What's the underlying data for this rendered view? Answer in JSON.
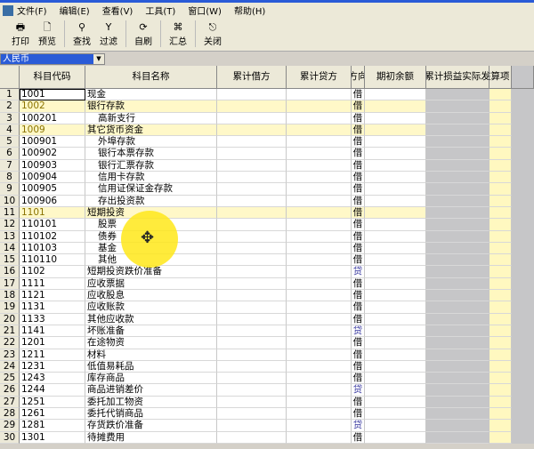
{
  "menu": [
    "文件(F)",
    "编辑(E)",
    "查看(V)",
    "工具(T)",
    "窗口(W)",
    "帮助(H)"
  ],
  "toolbar": [
    {
      "label": "打印",
      "icon": "printer-icon",
      "glyph": "🖶"
    },
    {
      "label": "预览",
      "icon": "preview-icon",
      "glyph": "🗋"
    },
    {
      "label": "查找",
      "icon": "binoculars-icon",
      "glyph": "⚲"
    },
    {
      "label": "过滤",
      "icon": "filter-icon",
      "glyph": "Y"
    },
    {
      "label": "自刷",
      "icon": "refresh-icon",
      "glyph": "⟳"
    },
    {
      "label": "汇总",
      "icon": "summary-icon",
      "glyph": "⌘"
    },
    {
      "label": "关闭",
      "icon": "exit-door-icon",
      "glyph": "⎋"
    }
  ],
  "currency": "人民币",
  "columns": [
    "",
    "科目代码",
    "科目名称",
    "累计借方",
    "累计贷方",
    "方向",
    "期初余额",
    "本年累计损益实际发生额",
    "核算项目"
  ],
  "colors": {
    "highlight": "#fff8c8",
    "gray": "#c6c6c8",
    "credit": "#3a3aa0"
  },
  "rows": [
    [
      "1",
      "1001",
      "现金",
      "借",
      0,
      0
    ],
    [
      "2",
      "1002",
      "银行存款",
      "借",
      0,
      1
    ],
    [
      "3",
      "100201",
      "高新支行",
      "借",
      1,
      0
    ],
    [
      "4",
      "1009",
      "其它货币资金",
      "借",
      0,
      1
    ],
    [
      "5",
      "100901",
      "外埠存款",
      "借",
      1,
      0
    ],
    [
      "6",
      "100902",
      "银行本票存款",
      "借",
      1,
      0
    ],
    [
      "7",
      "100903",
      "银行汇票存款",
      "借",
      1,
      0
    ],
    [
      "8",
      "100904",
      "信用卡存款",
      "借",
      1,
      0
    ],
    [
      "9",
      "100905",
      "信用证保证金存款",
      "借",
      1,
      0
    ],
    [
      "10",
      "100906",
      "存出投资款",
      "借",
      1,
      0
    ],
    [
      "11",
      "1101",
      "短期投资",
      "借",
      0,
      1
    ],
    [
      "12",
      "110101",
      "股票",
      "借",
      1,
      0
    ],
    [
      "13",
      "110102",
      "债券",
      "借",
      1,
      0
    ],
    [
      "14",
      "110103",
      "基金",
      "借",
      1,
      0
    ],
    [
      "15",
      "110110",
      "其他",
      "借",
      1,
      0
    ],
    [
      "16",
      "1102",
      "短期投资跌价准备",
      "贷",
      0,
      0
    ],
    [
      "17",
      "1111",
      "应收票据",
      "借",
      0,
      0
    ],
    [
      "18",
      "1121",
      "应收股息",
      "借",
      0,
      0
    ],
    [
      "19",
      "1131",
      "应收账款",
      "借",
      0,
      0
    ],
    [
      "20",
      "1133",
      "其他应收款",
      "借",
      0,
      0
    ],
    [
      "21",
      "1141",
      "坏账准备",
      "贷",
      0,
      0
    ],
    [
      "22",
      "1201",
      "在途物资",
      "借",
      0,
      0
    ],
    [
      "23",
      "1211",
      "材料",
      "借",
      0,
      0
    ],
    [
      "24",
      "1231",
      "低值易耗品",
      "借",
      0,
      0
    ],
    [
      "25",
      "1243",
      "库存商品",
      "借",
      0,
      0
    ],
    [
      "26",
      "1244",
      "商品进销差价",
      "贷",
      0,
      0
    ],
    [
      "27",
      "1251",
      "委托加工物资",
      "借",
      0,
      0
    ],
    [
      "28",
      "1261",
      "委托代销商品",
      "借",
      0,
      0
    ],
    [
      "29",
      "1281",
      "存货跌价准备",
      "贷",
      0,
      0
    ],
    [
      "30",
      "1301",
      "待摊费用",
      "借",
      0,
      0
    ]
  ]
}
